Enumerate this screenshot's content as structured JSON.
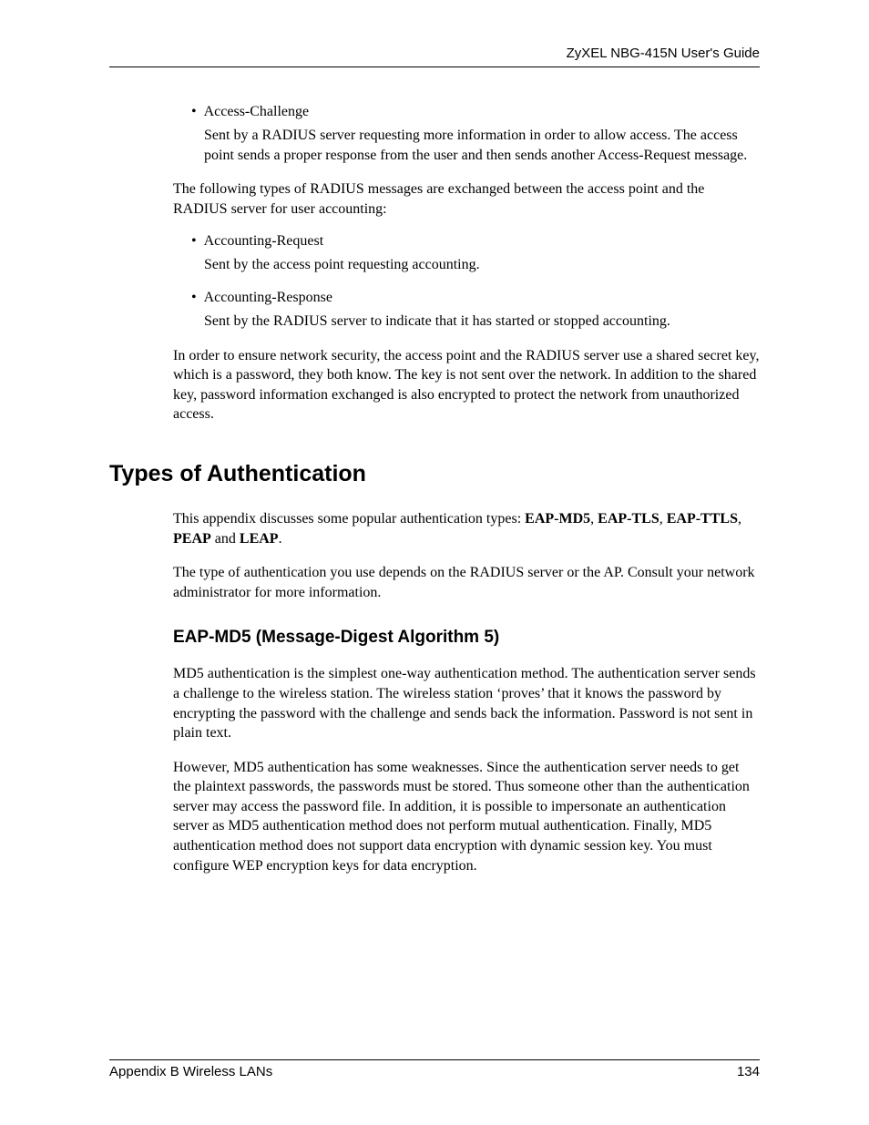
{
  "header": {
    "guide_title": "ZyXEL NBG-415N User's Guide"
  },
  "content": {
    "bullets_a": [
      {
        "label": "Access-Challenge",
        "desc": "Sent by a RADIUS server requesting more information in order to allow access. The access point sends a proper response from the user and then sends another Access-Request message."
      }
    ],
    "para1": "The following types of RADIUS messages are exchanged between the access point and the RADIUS server for user accounting:",
    "bullets_b": [
      {
        "label": "Accounting-Request",
        "desc": "Sent by the access point requesting accounting."
      },
      {
        "label": "Accounting-Response",
        "desc": "Sent by the RADIUS server to indicate that it has started or stopped accounting."
      }
    ],
    "para2": "In order to ensure network security, the access point and the RADIUS server use a shared secret key, which is a password, they both know. The key is not sent over the network. In addition to the shared key, password information exchanged is also encrypted to protect the network from unauthorized access."
  },
  "section": {
    "title": "Types of Authentication",
    "intro_pre": "This appendix discusses some popular authentication types: ",
    "intro_types": [
      "EAP-MD5",
      "EAP-TLS",
      "EAP-TTLS",
      "PEAP",
      "LEAP"
    ],
    "intro_sep_comma": ", ",
    "intro_sep_and": " and ",
    "intro_post": ".",
    "para3": "The type of authentication you use depends on the RADIUS server or the AP. Consult your network administrator for more information.",
    "subsection_title": "EAP-MD5 (Message-Digest Algorithm 5)",
    "para4": "MD5 authentication is the simplest one-way authentication method. The authentication server sends a challenge to the wireless station. The wireless station ‘proves’ that it knows the password by encrypting the password with the challenge and sends back the information. Password is not sent in plain text.",
    "para5": "However, MD5 authentication has some weaknesses. Since the authentication server needs to get the plaintext passwords, the passwords must be stored. Thus someone other than the authentication server may access the password file. In addition, it is possible to impersonate an authentication server as MD5 authentication method does not perform mutual authentication. Finally, MD5 authentication method does not support data encryption with dynamic session key. You must configure WEP encryption keys for data encryption."
  },
  "footer": {
    "left": "Appendix B Wireless LANs",
    "right": "134"
  }
}
